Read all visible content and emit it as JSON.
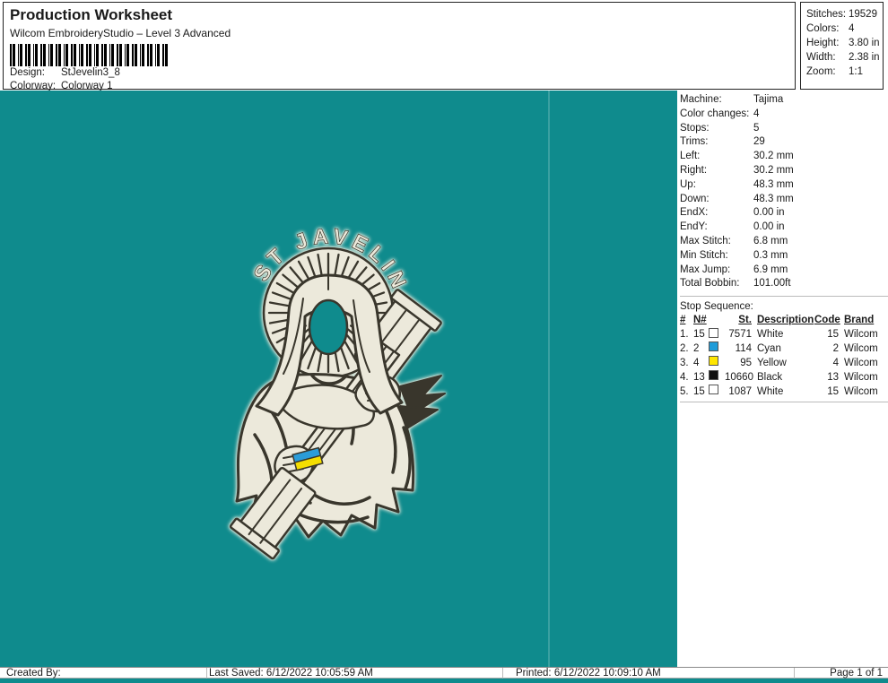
{
  "header": {
    "title": "Production Worksheet",
    "subtitle": "Wilcom EmbroideryStudio – Level 3 Advanced",
    "design_label": "Design:",
    "design_value": "StJevelin3_8",
    "colorway_label": "Colorway:",
    "colorway_value": "Colorway 1"
  },
  "summary": {
    "rows": [
      {
        "label": "Stitches:",
        "value": "19529"
      },
      {
        "label": "Colors:",
        "value": "4"
      },
      {
        "label": "Height:",
        "value": "3.80 in"
      },
      {
        "label": "Width:",
        "value": "2.38 in"
      },
      {
        "label": "Zoom:",
        "value": "1:1"
      }
    ]
  },
  "machine_info": {
    "rows": [
      {
        "label": "Machine:",
        "value": "Tajima"
      },
      {
        "label": "Color changes:",
        "value": "4"
      },
      {
        "label": "Stops:",
        "value": "5"
      },
      {
        "label": "Trims:",
        "value": "29"
      },
      {
        "label": "Left:",
        "value": "30.2 mm"
      },
      {
        "label": "Right:",
        "value": "30.2 mm"
      },
      {
        "label": "Up:",
        "value": "48.3 mm"
      },
      {
        "label": "Down:",
        "value": "48.3 mm"
      },
      {
        "label": "EndX:",
        "value": "0.00 in"
      },
      {
        "label": "EndY:",
        "value": "0.00 in"
      },
      {
        "label": "Max Stitch:",
        "value": "6.8 mm"
      },
      {
        "label": "Min Stitch:",
        "value": "0.3 mm"
      },
      {
        "label": "Max Jump:",
        "value": "6.9 mm"
      },
      {
        "label": "Total Bobbin:",
        "value": "101.00ft"
      }
    ]
  },
  "stop_sequence": {
    "title": "Stop Sequence:",
    "columns": {
      "num": "#",
      "n": "N#",
      "st": "St.",
      "description": "Description",
      "code": "Code",
      "brand": "Brand"
    },
    "rows": [
      {
        "num": "1.",
        "n": "15",
        "swatch": "#ffffff",
        "st": "7571",
        "description": "White",
        "code": "15",
        "brand": "Wilcom"
      },
      {
        "num": "2.",
        "n": "2",
        "swatch": "#1f9cd9",
        "st": "114",
        "description": "Cyan",
        "code": "2",
        "brand": "Wilcom"
      },
      {
        "num": "3.",
        "n": "4",
        "swatch": "#ffe600",
        "st": "95",
        "description": "Yellow",
        "code": "4",
        "brand": "Wilcom"
      },
      {
        "num": "4.",
        "n": "13",
        "swatch": "#111111",
        "st": "10660",
        "description": "Black",
        "code": "13",
        "brand": "Wilcom"
      },
      {
        "num": "5.",
        "n": "15",
        "swatch": "#ffffff",
        "st": "1087",
        "description": "White",
        "code": "15",
        "brand": "Wilcom"
      }
    ]
  },
  "design_canvas": {
    "arc_text": "ST JAVELIN",
    "colors": {
      "teal": "#0f8b8d",
      "cream": "#ece9db",
      "stitch_dark": "#39362c",
      "flag_blue": "#2b9cd8",
      "flag_yellow": "#f5de00"
    }
  },
  "footer": {
    "created_by": "Created By:",
    "last_saved": "Last Saved: 6/12/2022 10:05:59 AM",
    "printed": "Printed: 6/12/2022 10:09:10 AM",
    "page": "Page 1 of 1"
  }
}
